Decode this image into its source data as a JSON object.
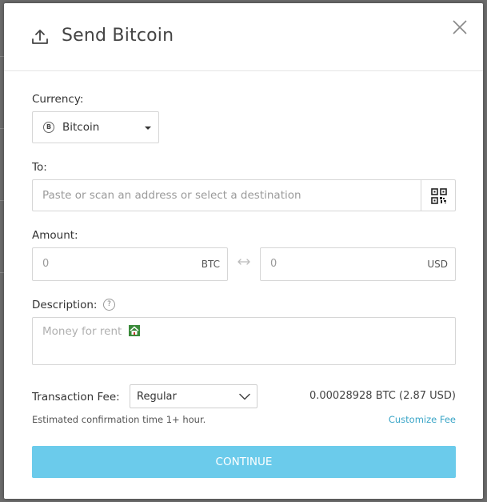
{
  "modal": {
    "title": "Send Bitcoin",
    "header_icon": "upload-icon",
    "close_icon": "close-icon"
  },
  "currency": {
    "label": "Currency:",
    "selected": "Bitcoin",
    "icon": "bitcoin-icon",
    "icon_glyph": "B"
  },
  "to": {
    "label": "To:",
    "placeholder": "Paste or scan an address or select a destination",
    "qr_icon": "qr-code-icon"
  },
  "amount": {
    "label": "Amount:",
    "crypto_value": "0",
    "crypto_unit": "BTC",
    "fiat_value": "0",
    "fiat_unit": "USD",
    "swap_icon": "swap-arrows-icon"
  },
  "description": {
    "label": "Description:",
    "help_glyph": "?",
    "placeholder": "Money for rent"
  },
  "fee": {
    "label": "Transaction Fee:",
    "selected": "Regular",
    "amount": "0.00028928 BTC (2.87 USD)",
    "confirmation": "Estimated confirmation time 1+ hour.",
    "customize_label": "Customize Fee"
  },
  "actions": {
    "continue_label": "CONTINUE"
  },
  "colors": {
    "accent": "#6bcbeb",
    "link": "#3aa5c7"
  }
}
